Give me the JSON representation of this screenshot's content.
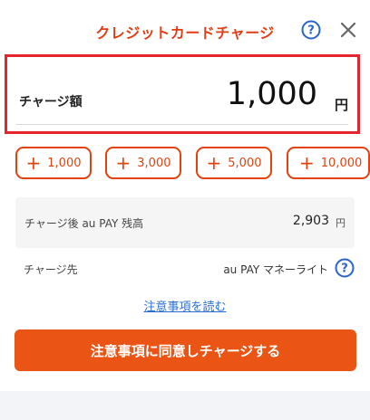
{
  "header": {
    "title": "クレジットカードチャージ",
    "help_icon": "question-circle-icon",
    "close_icon": "close-icon"
  },
  "amount": {
    "label": "チャージ額",
    "value": "1,000",
    "unit": "円"
  },
  "quick_add": [
    {
      "label": "1,000"
    },
    {
      "label": "3,000"
    },
    {
      "label": "5,000"
    },
    {
      "label": "10,000"
    }
  ],
  "quick_add_symbol": "+",
  "balance_after": {
    "label": "チャージ後 au PAY 残高",
    "value": "2,903",
    "unit": "円"
  },
  "destination": {
    "label": "チャージ先",
    "value": "au PAY マネーライト"
  },
  "notes_link": "注意事項を読む",
  "agree_button": "注意事項に同意しチャージする",
  "colors": {
    "accent": "#e4410f",
    "button": "#ea5515",
    "highlight_border": "#e4262c",
    "link": "#2a6fd2",
    "help_blue": "#2a63c9"
  }
}
